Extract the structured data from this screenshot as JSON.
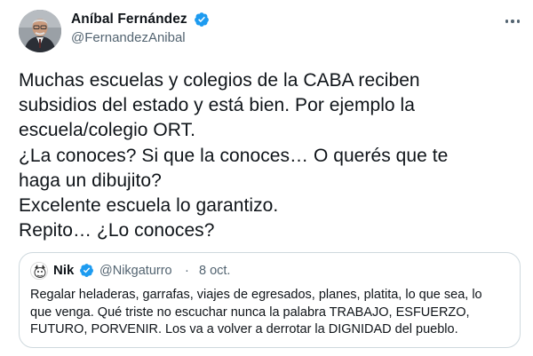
{
  "tweet": {
    "author": {
      "name": "Aníbal Fernández",
      "handle": "@FernandezAnibal",
      "verified": true
    },
    "text_lines": [
      "Muchas escuelas y colegios de la CABA reciben",
      "subsidios del estado y está bien. Por ejemplo la",
      "escuela/colegio ORT.",
      "¿La conoces? Si que la conoces… O querés que te",
      "haga un dibujito?",
      "Excelente escuela lo garantizo.",
      "Repito… ¿Lo conoces?"
    ],
    "quote": {
      "author_name": "Nik",
      "verified": true,
      "handle": "@Nikgaturro",
      "separator": "·",
      "date": "8 oct.",
      "text_lines": [
        "Regalar heladeras, garrafas, viajes de egresados, planes, platita, lo que sea, lo",
        "que venga. Qué triste no escuchar nunca la palabra TRABAJO, ESFUERZO,",
        "FUTURO, PORVENIR. Los va a volver a derrotar la DIGNIDAD del pueblo."
      ]
    }
  },
  "icons": {
    "verified": "verified-badge-icon",
    "more": "more-options-icon"
  },
  "colors": {
    "text_primary": "#0f1419",
    "text_secondary": "#536471",
    "verified_blue": "#1d9bf0",
    "border": "#cfd9de"
  }
}
